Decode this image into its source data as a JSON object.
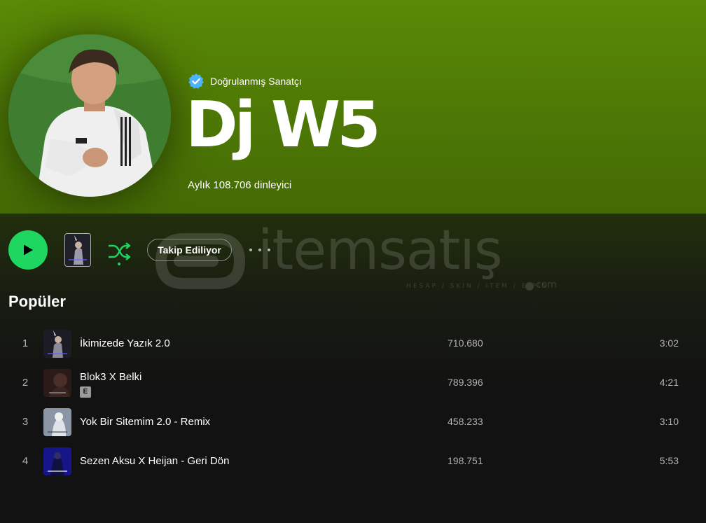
{
  "artist": {
    "verified_label": "Doğrulanmış Sanatçı",
    "name": "Dj W5",
    "monthly_listeners": "Aylık 108.706 dinleyici"
  },
  "actions": {
    "follow_label": "Takip Ediliyor"
  },
  "watermark": {
    "text": "itemsatış",
    "subtext": "HESAP / SKIN / ITEM / E-PIN",
    "suffix": "com"
  },
  "popular": {
    "title": "Popüler",
    "tracks": [
      {
        "number": "1",
        "title": "İkimizede Yazık 2.0",
        "plays": "710.680",
        "duration": "3:02",
        "explicit": false
      },
      {
        "number": "2",
        "title": "Blok3 X Belki",
        "plays": "789.396",
        "duration": "4:21",
        "explicit": true,
        "badge": "E"
      },
      {
        "number": "3",
        "title": "Yok Bir Sitemim 2.0 - Remix",
        "plays": "458.233",
        "duration": "3:10",
        "explicit": false
      },
      {
        "number": "4",
        "title": "Sezen Aksu X Heijan - Geri Dön",
        "plays": "198.751",
        "duration": "5:53",
        "explicit": false
      }
    ]
  },
  "colors": {
    "accent": "#1ed760",
    "hero": "#5a8a06",
    "background": "#121212",
    "verified": "#4cb3ff"
  }
}
